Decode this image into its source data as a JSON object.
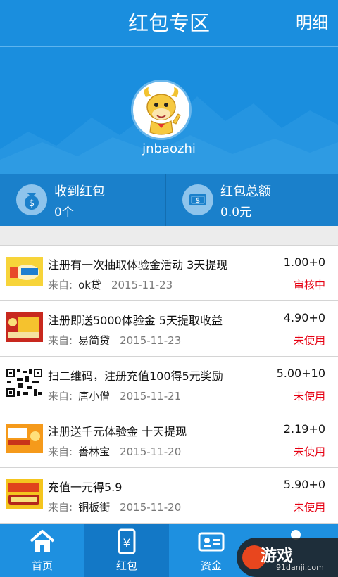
{
  "header": {
    "title": "红包专区",
    "detail": "明细"
  },
  "profile": {
    "username": "jnbaozhi"
  },
  "stats": {
    "received_label": "收到红包",
    "received_value": "0个",
    "total_label": "红包总额",
    "total_value": "0.0元"
  },
  "list": {
    "from_prefix": "来自:",
    "items": [
      {
        "title": "注册有一次抽取体验金活动 3天提现",
        "source": "ok贷",
        "date": "2015-11-23",
        "amount": "1.00+0",
        "status": "审核中"
      },
      {
        "title": "注册即送5000体验金 5天提取收益",
        "source": "易简贷",
        "date": "2015-11-23",
        "amount": "4.90+0",
        "status": "未使用"
      },
      {
        "title": "扫二维码，注册充值100得5元奖励",
        "source": "唐小僧",
        "date": "2015-11-21",
        "amount": "5.00+10",
        "status": "未使用"
      },
      {
        "title": "注册送千元体验金 十天提现",
        "source": "善林宝",
        "date": "2015-11-20",
        "amount": "2.19+0",
        "status": "未使用"
      },
      {
        "title": "充值一元得5.9",
        "source": "铜板街",
        "date": "2015-11-20",
        "amount": "5.90+0",
        "status": "未使用"
      }
    ]
  },
  "tabs": {
    "home": "首页",
    "redpacket": "红包",
    "funds": "资金"
  },
  "watermark": {
    "brand": "游戏",
    "url": "91danji.com"
  },
  "colors": {
    "primary": "#1a8ede",
    "status_red": "#e60012"
  }
}
